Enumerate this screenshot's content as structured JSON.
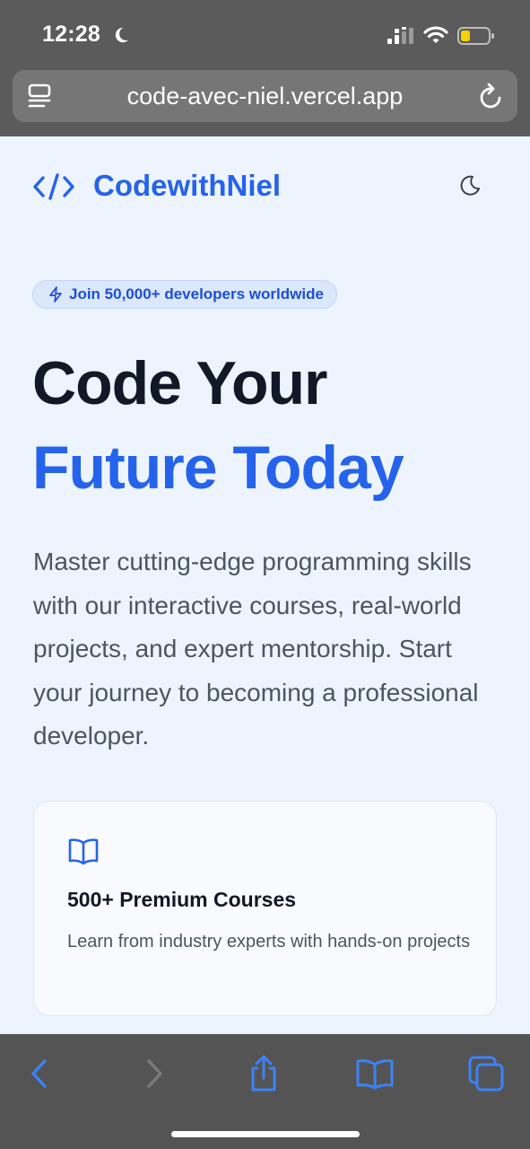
{
  "status_bar": {
    "time": "12:28",
    "icons": [
      "moon-icon",
      "signal-icon",
      "wifi-icon",
      "battery-icon"
    ]
  },
  "address_bar": {
    "url": "code-avec-niel.vercel.app",
    "icons": [
      "reader-menu-icon",
      "reload-icon"
    ]
  },
  "header": {
    "brand_name": "CodewithNiel",
    "brand_icon": "code-brackets-icon",
    "theme_toggle_icon": "moon-icon"
  },
  "hero": {
    "badge_icon": "lightning-icon",
    "badge_text": "Join 50,000+ developers worldwide",
    "title_line1": "Code Your",
    "title_line2": "Future Today",
    "description": "Master cutting-edge programming skills with our interactive courses, real-world projects, and expert mentorship. Start your journey to becoming a professional developer."
  },
  "features": [
    {
      "icon": "book-icon",
      "title": "500+ Premium Courses",
      "description": "Learn from industry experts with hands-on projects"
    }
  ],
  "toolbar": {
    "icons": [
      "back-icon",
      "forward-icon",
      "share-icon",
      "bookmarks-icon",
      "tabs-icon"
    ]
  },
  "colors": {
    "accent": "#2563eb",
    "heading": "#111827",
    "body_text": "#4b5563",
    "page_bg": "#eef4fd",
    "chrome_bg": "#5b5b5b"
  }
}
